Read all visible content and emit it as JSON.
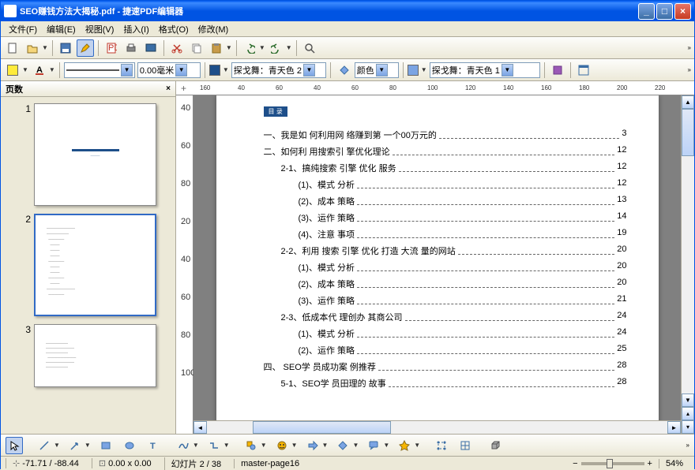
{
  "window": {
    "title": "SEO赚钱方法大揭秘.pdf - 捷速PDF编辑器",
    "min": "_",
    "max": "□",
    "close": "×"
  },
  "menu": {
    "file": "文件(F)",
    "edit": "编辑(E)",
    "view": "视图(V)",
    "insert": "插入(I)",
    "format": "格式(O)",
    "modify": "修改(M)"
  },
  "toolbar2": {
    "line_width": "0.00毫米",
    "style1_label": "探戈舞：青天色 2",
    "color_label": "颜色",
    "style2_label": "探戈舞：青天色 1"
  },
  "sidebar": {
    "title": "页数",
    "thumbs": [
      "1",
      "2",
      "3"
    ]
  },
  "ruler_h": [
    "160",
    "40",
    "60",
    "40",
    "60",
    "80",
    "100",
    "120",
    "140",
    "160",
    "180",
    "200",
    "220"
  ],
  "ruler_v": [
    "40",
    "60",
    "80",
    "20",
    "40",
    "60",
    "80",
    "100"
  ],
  "toc": {
    "tag": "目 录",
    "items": [
      {
        "ind": 0,
        "t": "一、我是如 何利用网 络赚到第 一个00万元的",
        "p": "3"
      },
      {
        "ind": 0,
        "t": "二、如何利 用搜索引 擎优化理论",
        "p": "12"
      },
      {
        "ind": 1,
        "t": "2-1、搞纯搜索 引擎 优化 服务",
        "p": "12"
      },
      {
        "ind": 2,
        "t": "(1)、模式 分析",
        "p": "12"
      },
      {
        "ind": 2,
        "t": "(2)、成本 策略",
        "p": "13"
      },
      {
        "ind": 2,
        "t": "(3)、运作 策略",
        "p": "14"
      },
      {
        "ind": 2,
        "t": "(4)、注意 事项",
        "p": "19"
      },
      {
        "ind": 1,
        "t": "2-2、利用 搜索 引擎 优化 打造 大流 量的网站",
        "p": "20"
      },
      {
        "ind": 2,
        "t": "(1)、模式 分析",
        "p": "20"
      },
      {
        "ind": 2,
        "t": "(2)、成本 策略",
        "p": "20"
      },
      {
        "ind": 2,
        "t": "(3)、运作 策略",
        "p": "21"
      },
      {
        "ind": 1,
        "t": "2-3、低成本代 理创办 其商公司",
        "p": "24"
      },
      {
        "ind": 2,
        "t": "(1)、模式 分析",
        "p": "24"
      },
      {
        "ind": 2,
        "t": "(2)、运作 策略",
        "p": "25"
      },
      {
        "ind": 0,
        "t": "四、 SEO学 员成功案 例推荐",
        "p": "28"
      },
      {
        "ind": 1,
        "t": "5-1、SEO学 员田理的 故事",
        "p": "28"
      }
    ]
  },
  "status": {
    "coords": "-71.71 / -88.44",
    "size": "0.00 x 0.00",
    "slide": "幻灯片 2 / 38",
    "master": "master-page16",
    "zoom": "54%"
  }
}
